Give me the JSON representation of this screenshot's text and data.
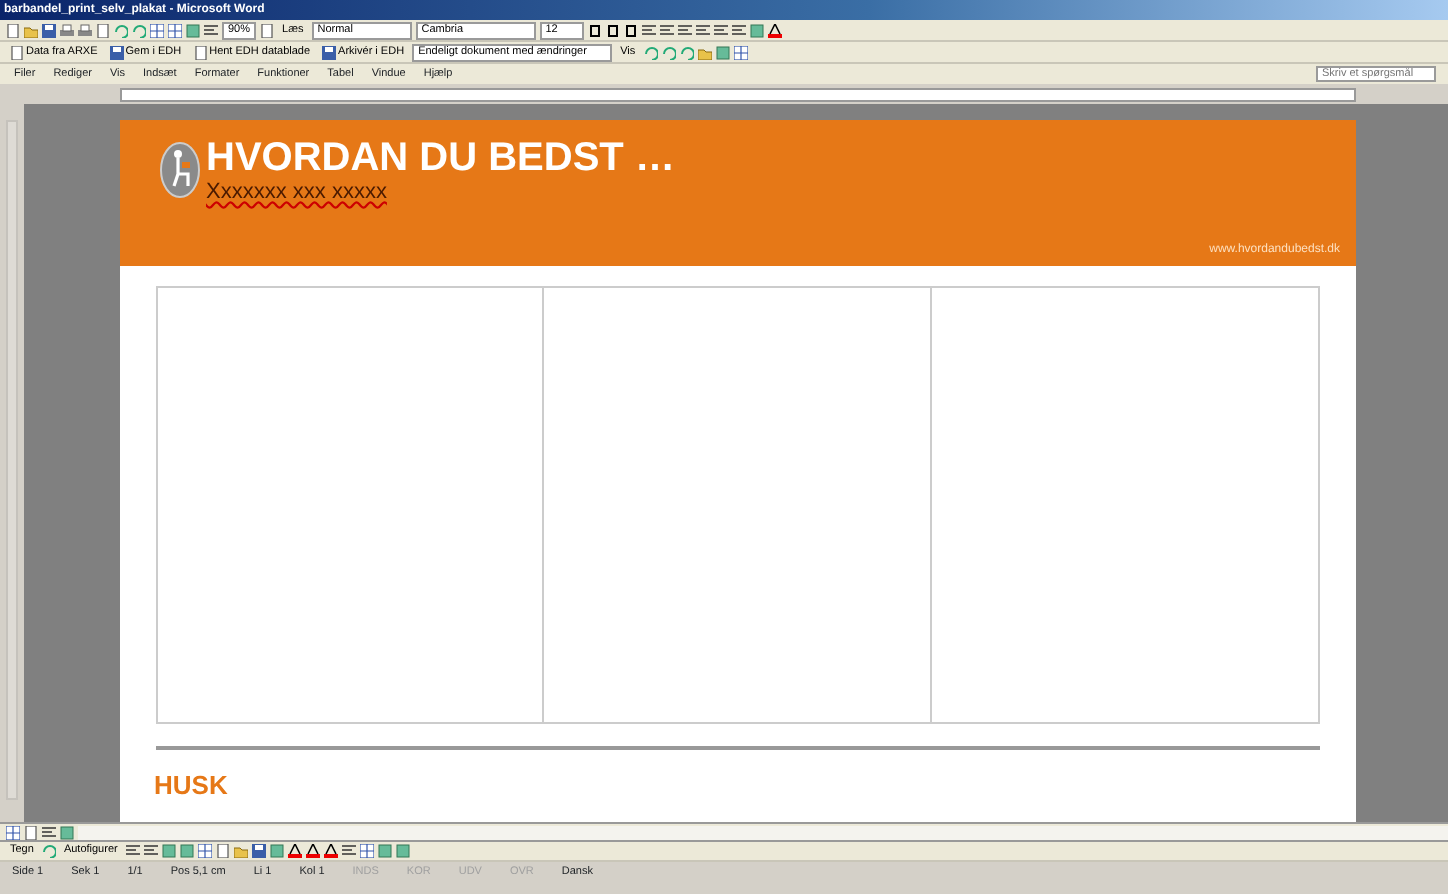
{
  "window": {
    "title": "barbandel_print_selv_plakat - Microsoft Word"
  },
  "standard_toolbar": {
    "zoom": "90%",
    "read_button": "Læs",
    "style": "Normal",
    "font": "Cambria",
    "size": "12"
  },
  "edh_toolbar": {
    "buttons": [
      "Data fra ARXE",
      "Gem i EDH",
      "Hent EDH datablade",
      "Arkivér i EDH"
    ],
    "markup_view": "Endeligt dokument med ændringer",
    "show_button": "Vis"
  },
  "menu": [
    {
      "label": "Filer"
    },
    {
      "label": "Rediger"
    },
    {
      "label": "Vis"
    },
    {
      "label": "Indsæt"
    },
    {
      "label": "Formater"
    },
    {
      "label": "Funktioner"
    },
    {
      "label": "Tabel"
    },
    {
      "label": "Vindue"
    },
    {
      "label": "Hjælp"
    }
  ],
  "help_box": {
    "placeholder": "Skriv et spørgsmål"
  },
  "document": {
    "header": {
      "title": "HVORDAN DU BEDST …",
      "subtitle": "Xxxxxxx xxx xxxxx",
      "website": "www.hvordandubedst.dk"
    },
    "section_heading": "HUSK"
  },
  "drawing_toolbar": {
    "draw_menu": "Tegn",
    "autoshapes_menu": "Autofigurer"
  },
  "status_bar": [
    {
      "text": "Side 1",
      "disabled": false
    },
    {
      "text": "Sek 1",
      "disabled": false
    },
    {
      "text": "1/1",
      "disabled": false
    },
    {
      "text": "Pos 5,1 cm",
      "disabled": false
    },
    {
      "text": "Li 1",
      "disabled": false
    },
    {
      "text": "Kol 1",
      "disabled": false
    },
    {
      "text": "INDS",
      "disabled": true
    },
    {
      "text": "KOR",
      "disabled": true
    },
    {
      "text": "UDV",
      "disabled": true
    },
    {
      "text": "OVR",
      "disabled": true
    },
    {
      "text": "Dansk",
      "disabled": false
    }
  ]
}
